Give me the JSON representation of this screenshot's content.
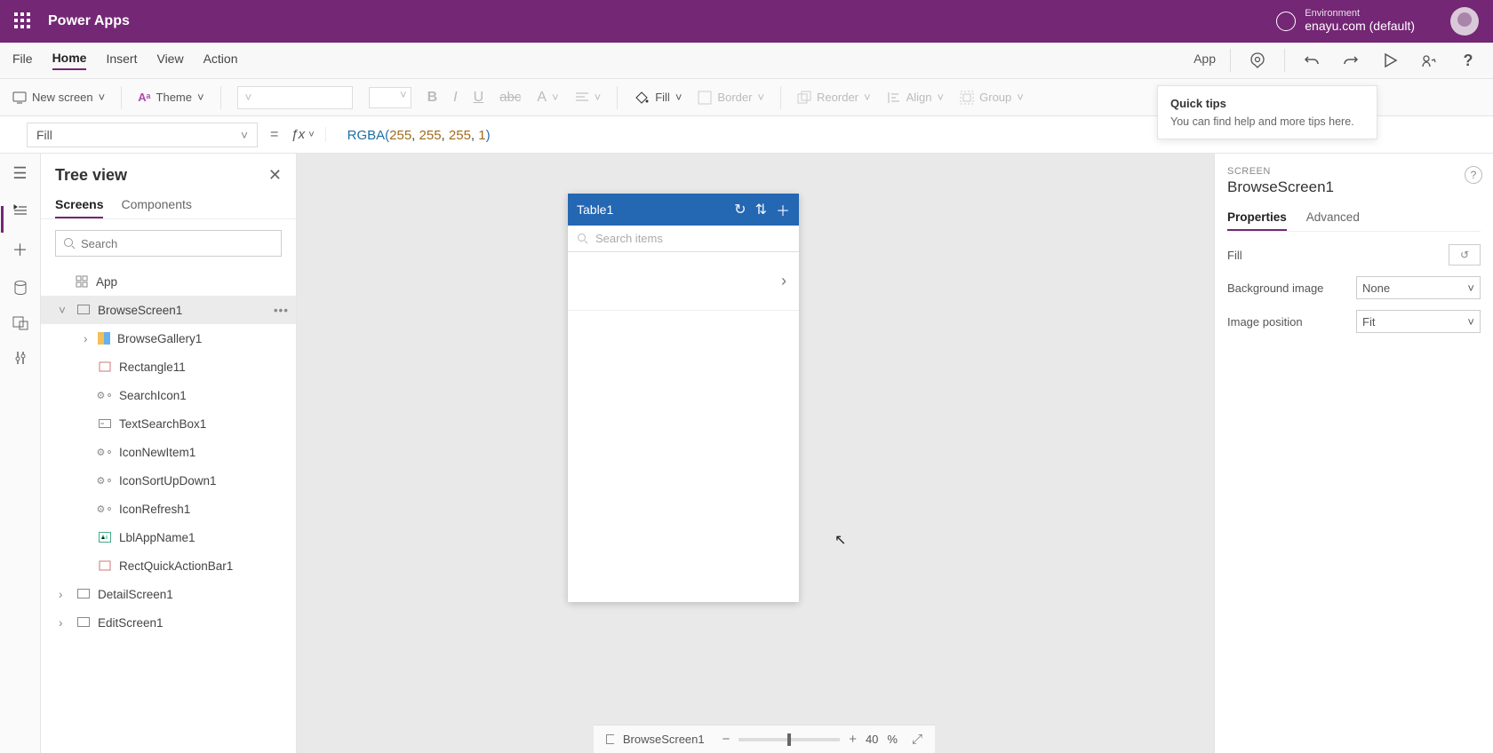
{
  "header": {
    "app_title": "Power Apps",
    "env_label": "Environment",
    "env_name": "enayu.com (default)"
  },
  "menubar": {
    "items": [
      "File",
      "Home",
      "Insert",
      "View",
      "Action"
    ],
    "active_index": 1,
    "right_label": "App"
  },
  "toolbar": {
    "new_screen": "New screen",
    "theme": "Theme",
    "fill": "Fill",
    "border": "Border",
    "reorder": "Reorder",
    "align": "Align",
    "group": "Group"
  },
  "formula": {
    "property": "Fill",
    "fn": "RGBA",
    "args": [
      "255",
      "255",
      "255",
      "1"
    ]
  },
  "quicktips": {
    "title": "Quick tips",
    "body": "You can find help and more tips here."
  },
  "treeview": {
    "title": "Tree view",
    "tabs": [
      "Screens",
      "Components"
    ],
    "active_tab": 0,
    "search_placeholder": "Search",
    "nodes": {
      "app": "App",
      "browse_screen": "BrowseScreen1",
      "browse_gallery": "BrowseGallery1",
      "children": [
        "Rectangle11",
        "SearchIcon1",
        "TextSearchBox1",
        "IconNewItem1",
        "IconSortUpDown1",
        "IconRefresh1",
        "LblAppName1",
        "RectQuickActionBar1"
      ],
      "detail_screen": "DetailScreen1",
      "edit_screen": "EditScreen1"
    }
  },
  "canvas": {
    "phone_title": "Table1",
    "search_placeholder": "Search items"
  },
  "properties": {
    "category": "SCREEN",
    "name": "BrowseScreen1",
    "tabs": [
      "Properties",
      "Advanced"
    ],
    "active_tab": 0,
    "rows": {
      "fill": "Fill",
      "bg_image_label": "Background image",
      "bg_image_value": "None",
      "img_pos_label": "Image position",
      "img_pos_value": "Fit"
    }
  },
  "statusbar": {
    "screen": "BrowseScreen1",
    "zoom": "40",
    "zoom_suffix": "%"
  }
}
